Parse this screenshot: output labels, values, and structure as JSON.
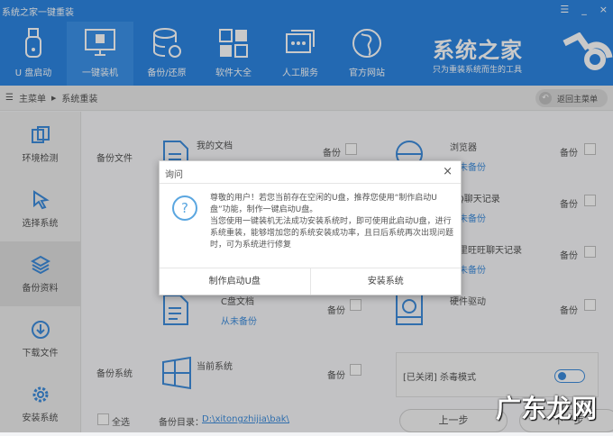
{
  "window": {
    "title": "系统之家一键重装",
    "menu_icon": "☰",
    "minimize": "_",
    "close": "×"
  },
  "nav": {
    "items": [
      {
        "label": "U 盘启动",
        "icon": "usb-icon"
      },
      {
        "label": "一键装机",
        "icon": "monitor-windows-icon"
      },
      {
        "label": "备份/还原",
        "icon": "database-icon"
      },
      {
        "label": "软件大全",
        "icon": "apps-icon"
      },
      {
        "label": "人工服务",
        "icon": "chat-icon"
      },
      {
        "label": "官方网站",
        "icon": "globe-icon"
      }
    ],
    "active": 1
  },
  "brand": {
    "name": "系统之家",
    "slogan": "只为重装系统而生的工具"
  },
  "breadcrumb": {
    "root": "主菜单",
    "current": "系统重装",
    "back": "返回主菜单"
  },
  "sidebar": {
    "items": [
      {
        "label": "环境检测"
      },
      {
        "label": "选择系统"
      },
      {
        "label": "备份资料"
      },
      {
        "label": "下载文件"
      },
      {
        "label": "安装系统"
      }
    ],
    "active": 2
  },
  "main": {
    "backup_files_label": "备份文件",
    "backup_system_label": "备份系统",
    "backup_label": "备份",
    "items": [
      {
        "name": "我的文档",
        "status": ""
      },
      {
        "name": "浏览器",
        "status": "从未备份"
      },
      {
        "name": "QQ聊天记录",
        "status": "从未备份"
      },
      {
        "name": "阿里旺旺聊天记录",
        "status": "从未备份"
      },
      {
        "name": "C盘文档",
        "status": "从未备份"
      },
      {
        "name": "硬件驱动",
        "status": ""
      },
      {
        "name": "当前系统",
        "status": ""
      }
    ],
    "antivirus": "[已关闭] 杀毒模式",
    "antivirus_on": false,
    "select_all": "全选",
    "backup_dir_label": "备份目录：",
    "backup_dir": "D:\\xitongzhijia\\bak\\",
    "prev": "上一步",
    "next": "下一步"
  },
  "dialog": {
    "title": "询问",
    "close": "×",
    "icon": "?",
    "lines": [
      "尊敬的用户！若您当前存在空闲的U盘，推荐您使用“制作启动U盘”功能，制作一键启动U盘。",
      "当您使用一键装机无法成功安装系统时，即可使用此启动U盘，进行系统重装，能够增加您的系统安装成功率，且日后系统再次出现问题时，可为系统进行修复"
    ],
    "btn_make": "制作启动U盘",
    "btn_install": "安装系统"
  },
  "watermark": "广东龙网"
}
